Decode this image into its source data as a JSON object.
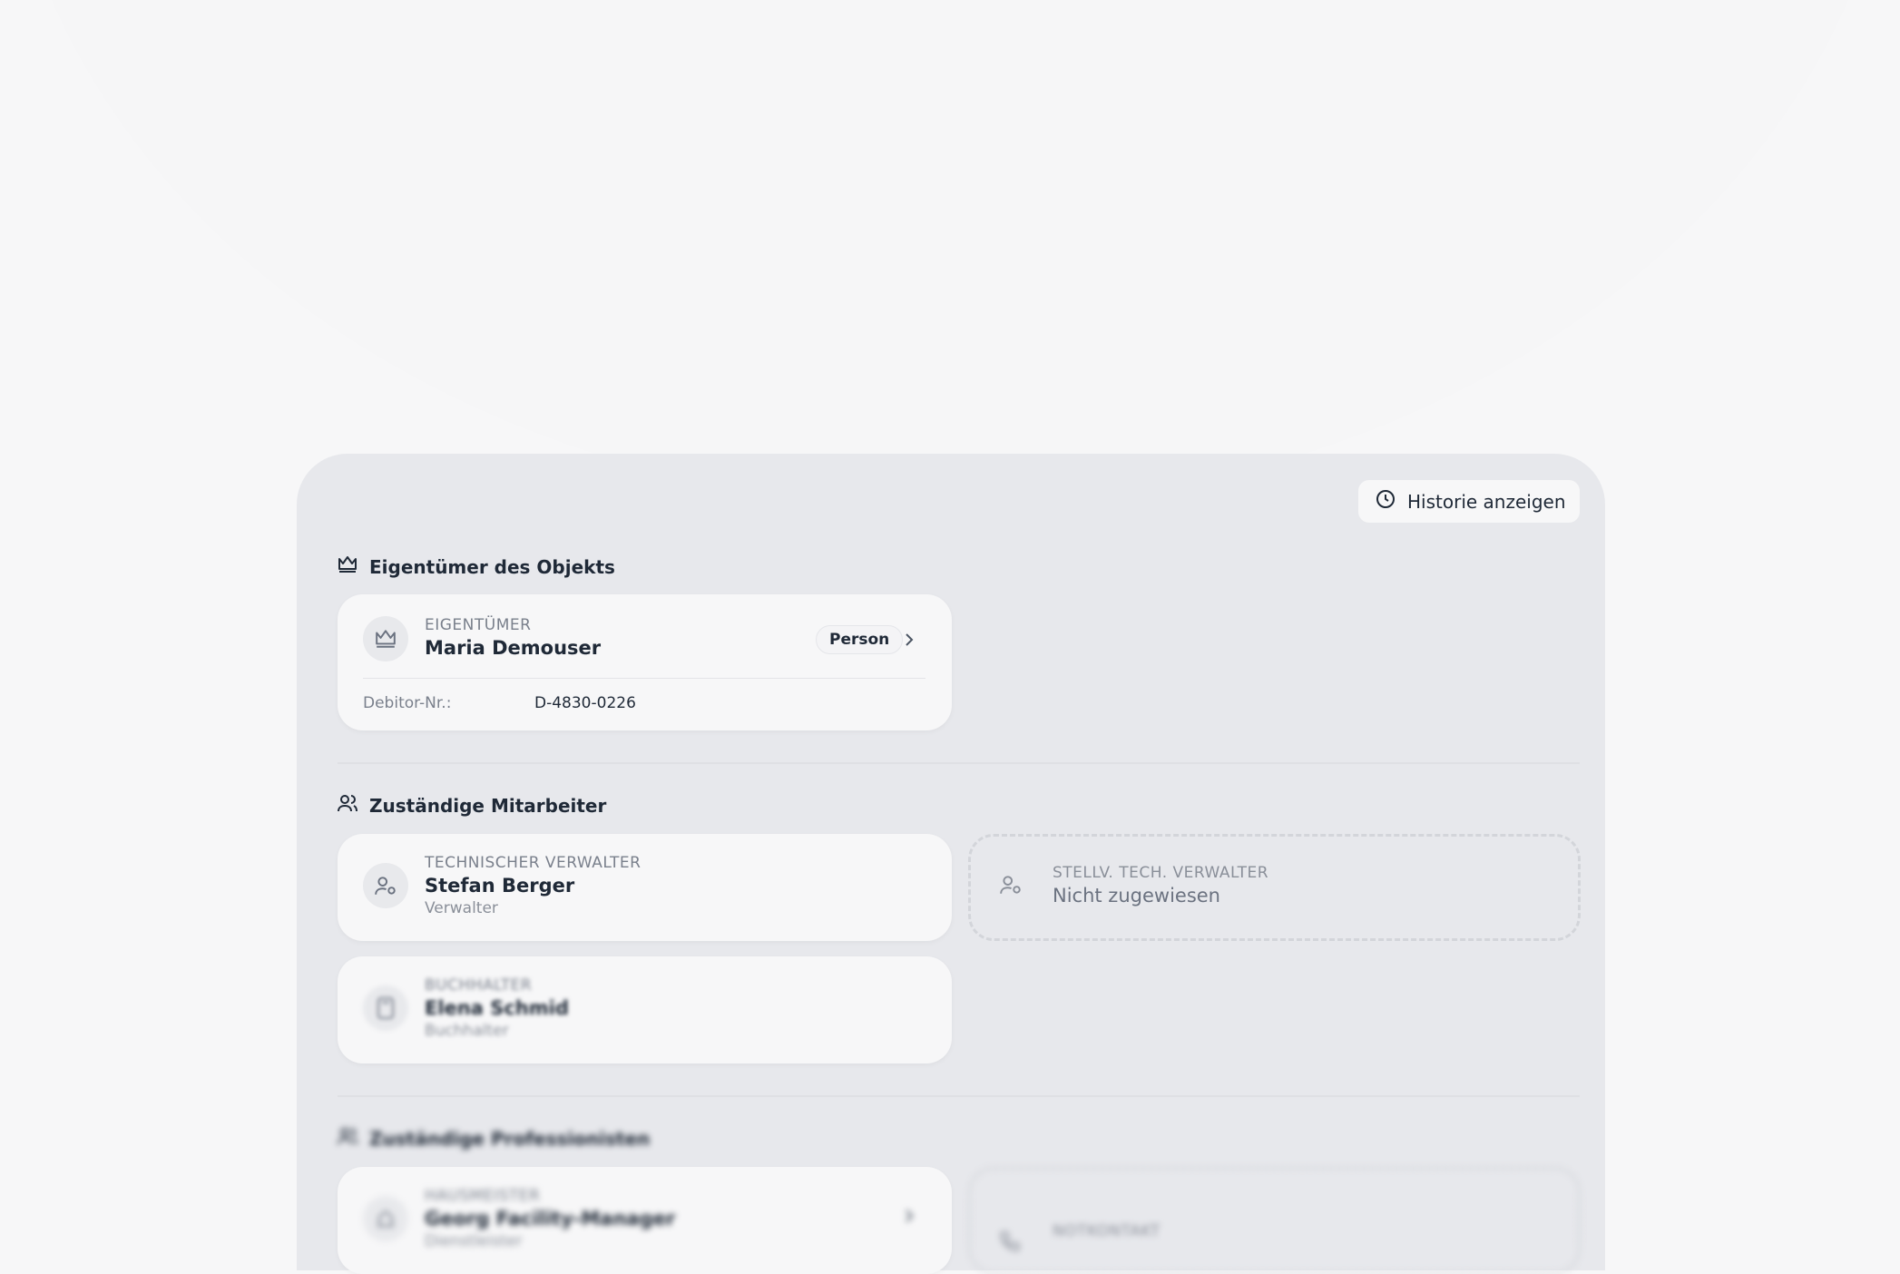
{
  "history_button": {
    "label": "Historie anzeigen",
    "icon": "clock-icon"
  },
  "owner_section": {
    "title": "Eigentümer des Objekts",
    "card": {
      "role": "EIGENTÜMER",
      "name": "Maria Demouser",
      "badge": "Person",
      "debitor_label": "Debitor-Nr.:",
      "debitor_value": "D-4830-0226"
    }
  },
  "staff_section": {
    "title": "Zuständige Mitarbeiter",
    "technical": {
      "role": "TECHNISCHER VERWALTER",
      "name": "Stefan Berger",
      "sub": "Verwalter"
    },
    "deputy": {
      "role": "STELLV. TECH. VERWALTER",
      "name": "Nicht zugewiesen"
    },
    "accountant": {
      "role": "BUCHHALTER",
      "name": "Elena Schmid",
      "sub": "Buchhalter"
    }
  },
  "pro_section": {
    "title": "Zuständige Professionisten",
    "caretaker": {
      "role": "HAUSMEISTER",
      "name": "Georg Facility-Manager",
      "sub": "Dienstleister"
    },
    "emergency": {
      "role": "NOTKONTAKT"
    }
  },
  "colors": {
    "panel": "#e7e8ec",
    "card": "#f7f7f8",
    "text": "#1f2937",
    "muted": "#7a808c"
  }
}
